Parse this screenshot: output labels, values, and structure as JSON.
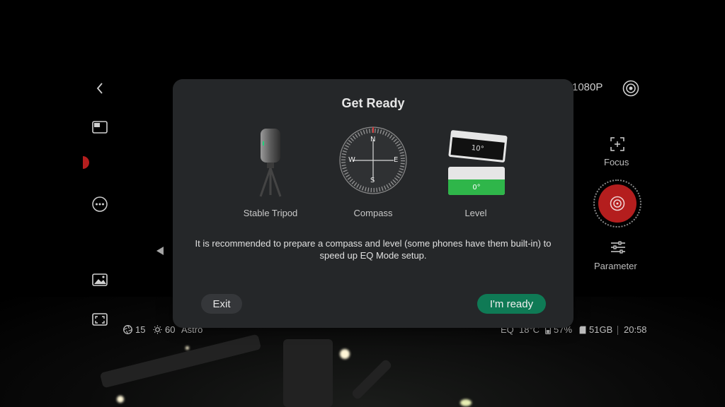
{
  "dialog": {
    "title": "Get Ready",
    "items": [
      {
        "label": "Stable Tripod",
        "icon": "tripod-icon"
      },
      {
        "label": "Compass",
        "icon": "compass-icon"
      },
      {
        "label": "Level",
        "icon": "level-icon"
      }
    ],
    "message": "It is recommended to prepare a compass and level (some phones have them built-in) to speed up EQ Mode setup.",
    "exit_label": "Exit",
    "ready_label": "I'm ready"
  },
  "compass": {
    "n": "N",
    "s": "S",
    "e": "E",
    "w": "W"
  },
  "level": {
    "tilted_reading": "10°",
    "flat_reading": "0°"
  },
  "camera": {
    "resolution": "1080P",
    "focus_label": "Focus",
    "parameter_label": "Parameter"
  },
  "status": {
    "aperture": "15",
    "brightness": "60",
    "mode": "Astro",
    "eq": "EQ",
    "temperature": "18°C",
    "battery": "57%",
    "storage": "51GB",
    "time": "20:58"
  },
  "colors": {
    "accent_green": "#0f7a55",
    "shutter_red": "#b41e1e",
    "dialog_bg": "#252729"
  }
}
